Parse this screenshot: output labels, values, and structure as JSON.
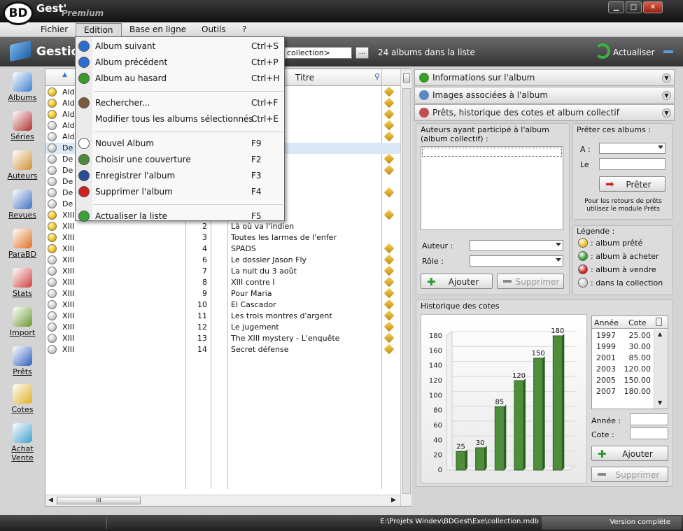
{
  "window": {
    "logo": "BD",
    "app_name": "Gest'",
    "edition": "Premium"
  },
  "menubar": [
    "Fichier",
    "Edition",
    "Base en ligne",
    "Outils",
    "?"
  ],
  "toolbar": {
    "title": "Gestion",
    "combo_value": "collection>",
    "more": "...",
    "count": "24 albums dans la liste",
    "refresh": "Actualiser"
  },
  "sidebar": [
    {
      "label": "Albums",
      "icon": "albums-icon",
      "color": "#3b7fd0"
    },
    {
      "label": "Séries",
      "icon": "series-icon",
      "color": "#b03030"
    },
    {
      "label": "Auteurs",
      "icon": "authors-icon",
      "color": "#d09030"
    },
    {
      "label": "Revues",
      "icon": "magazines-icon",
      "color": "#4070c0"
    },
    {
      "label": "ParaBD",
      "icon": "parabd-icon",
      "color": "#e07020"
    },
    {
      "label": "Stats",
      "icon": "stats-icon",
      "color": "#d04040"
    },
    {
      "label": "Import",
      "icon": "import-icon",
      "color": "#6a9a30"
    },
    {
      "label": "Prêts",
      "icon": "loans-icon",
      "color": "#3060c0"
    },
    {
      "label": "Cotes",
      "icon": "coins-icon",
      "color": "#e0b020"
    },
    {
      "label": "Achat Vente",
      "icon": "cart-icon",
      "color": "#40a0d0"
    }
  ],
  "list": {
    "header_title": "Titre",
    "scroll_thumb": "III",
    "rows": [
      {
        "serie": "Ald",
        "num": "",
        "title": "e",
        "dot": "gold",
        "pin": true
      },
      {
        "serie": "Ald",
        "num": "",
        "title": "",
        "dot": "gold",
        "pin": true
      },
      {
        "serie": "Ald",
        "num": "",
        "title": "",
        "dot": "gold",
        "pin": true
      },
      {
        "serie": "Ald",
        "num": "",
        "title": "",
        "dot": "grey",
        "pin": true
      },
      {
        "serie": "Ald",
        "num": "",
        "title": "",
        "dot": "grey",
        "pin": true
      },
      {
        "serie": "De",
        "num": "",
        "title": "anissaire test",
        "dot": "grey",
        "pin": false,
        "selected": true
      },
      {
        "serie": "De",
        "num": "",
        "title": "",
        "dot": "grey",
        "pin": true
      },
      {
        "serie": "De",
        "num": "",
        "title": "danger",
        "dot": "grey",
        "pin": true
      },
      {
        "serie": "De",
        "num": "",
        "title": "",
        "dot": "grey",
        "pin": false
      },
      {
        "serie": "De",
        "num": "",
        "title": "",
        "dot": "grey",
        "pin": true
      },
      {
        "serie": "De",
        "num": "",
        "title": "",
        "dot": "grey",
        "pin": false
      },
      {
        "serie": "XIII",
        "num": "",
        "title": "eil noir",
        "dot": "gold",
        "pin": true
      },
      {
        "serie": "XIII",
        "num": "2",
        "title": "Là où va l'indien",
        "dot": "gold",
        "pin": false
      },
      {
        "serie": "XIII",
        "num": "3",
        "title": "Toutes les larmes de l'enfer",
        "dot": "gold",
        "pin": false
      },
      {
        "serie": "XIII",
        "num": "4",
        "title": "SPADS",
        "dot": "gold",
        "pin": true
      },
      {
        "serie": "XIII",
        "num": "6",
        "title": "Le dossier Jason Fly",
        "dot": "grey",
        "pin": true
      },
      {
        "serie": "XIII",
        "num": "7",
        "title": "La nuit du 3 août",
        "dot": "grey",
        "pin": true
      },
      {
        "serie": "XIII",
        "num": "8",
        "title": "XIII contre I",
        "dot": "grey",
        "pin": true
      },
      {
        "serie": "XIII",
        "num": "9",
        "title": "Pour Maria",
        "dot": "grey",
        "pin": true
      },
      {
        "serie": "XIII",
        "num": "10",
        "title": "El Cascador",
        "dot": "grey",
        "pin": true
      },
      {
        "serie": "XIII",
        "num": "11",
        "title": "Les trois montres d'argent",
        "dot": "grey",
        "pin": true
      },
      {
        "serie": "XIII",
        "num": "12",
        "title": "Le jugement",
        "dot": "grey",
        "pin": true
      },
      {
        "serie": "XIII",
        "num": "13",
        "title": "The XIII mystery - L'enquête",
        "dot": "grey",
        "pin": true
      },
      {
        "serie": "XIII",
        "num": "14",
        "title": "Secret défense",
        "dot": "grey",
        "pin": true
      }
    ]
  },
  "edit_menu": [
    {
      "label": "Album suivant",
      "shortcut": "Ctrl+S",
      "icon": "next-arrow-icon",
      "color": "#2a6fd0"
    },
    {
      "label": "Album précédent",
      "shortcut": "Ctrl+P",
      "icon": "previous-arrow-icon",
      "color": "#2a6fd0"
    },
    {
      "label": "Album au hasard",
      "shortcut": "Ctrl+H",
      "icon": "random-question-icon",
      "color": "#3a9a2a"
    },
    {
      "label": "Rechercher...",
      "shortcut": "Ctrl+F",
      "icon": "magnifier-icon",
      "color": "#7a5a3a",
      "sep_before": true
    },
    {
      "label": "Modifier tous les albums sélectionnés",
      "shortcut": "Ctrl+E",
      "icon": "",
      "color": ""
    },
    {
      "label": "Nouvel Album",
      "shortcut": "F9",
      "icon": "new-document-icon",
      "color": "#ffffff",
      "sep_before": true
    },
    {
      "label": "Choisir une couverture",
      "shortcut": "F2",
      "icon": "picture-icon",
      "color": "#4a8a3a"
    },
    {
      "label": "Enregistrer l'album",
      "shortcut": "F3",
      "icon": "floppy-disk-icon",
      "color": "#2a4a9a"
    },
    {
      "label": "Supprimer l'album",
      "shortcut": "F4",
      "icon": "delete-cross-icon",
      "color": "#d02020"
    },
    {
      "label": "Actualiser la liste",
      "shortcut": "F5",
      "icon": "refresh-icon",
      "color": "#3aa03a",
      "sep_before": true
    }
  ],
  "panels": [
    {
      "label": "Informations sur l'album",
      "icon": "info-icon",
      "color": "#3a9a2a"
    },
    {
      "label": "Images associées à l'album",
      "icon": "images-icon",
      "color": "#5a8ac0"
    },
    {
      "label": "Prêts, historique des cotes et album collectif",
      "icon": "loans-panel-icon",
      "color": "#c05050"
    }
  ],
  "collectif": {
    "title": "Auteurs ayant participé à l'album (album collectif) :",
    "author_label": "Auteur :",
    "role_label": "Rôle :",
    "add": "Ajouter",
    "remove": "Supprimer"
  },
  "lend": {
    "title": "Prêter ces albums :",
    "to_label": "A :",
    "date_label": "Le",
    "button": "Prêter",
    "note": "Pour les retours de prêts utilisez le module Prêts"
  },
  "legend": {
    "title": "Légende :",
    "items": [
      {
        "label": ": album prêté",
        "color": "#f2c31c"
      },
      {
        "label": ": album à acheter",
        "color": "#30a030"
      },
      {
        "label": ": album à vendre",
        "color": "#d02020"
      },
      {
        "label": ": dans la collection",
        "color": "#cfcfcf"
      }
    ]
  },
  "history": {
    "title": "Historique des cotes",
    "col_year": "Année",
    "col_value": "Cote",
    "rows": [
      {
        "year": "1997",
        "value": "25.00"
      },
      {
        "year": "1999",
        "value": "30.00"
      },
      {
        "year": "2001",
        "value": "85.00"
      },
      {
        "year": "2003",
        "value": "120.00"
      },
      {
        "year": "2005",
        "value": "150.00"
      },
      {
        "year": "2007",
        "value": "180.00"
      }
    ],
    "year_label": "Année :",
    "value_label": "Cote :",
    "add": "Ajouter",
    "remove": "Supprimer"
  },
  "chart_data": {
    "type": "bar",
    "categories": [
      "1997",
      "1999",
      "2001",
      "2003",
      "2005",
      "2007"
    ],
    "values": [
      25,
      30,
      85,
      120,
      150,
      180
    ],
    "ylim": [
      0,
      180
    ],
    "yticks": [
      0,
      20,
      40,
      60,
      80,
      100,
      120,
      140,
      160,
      180
    ],
    "show_category_labels": false,
    "color": "#4e8e3a",
    "grid": true
  },
  "statusbar": {
    "path": "E:\\Projets Windev\\BDGest\\Exe\\collection.mdb",
    "version": "Version complète"
  }
}
